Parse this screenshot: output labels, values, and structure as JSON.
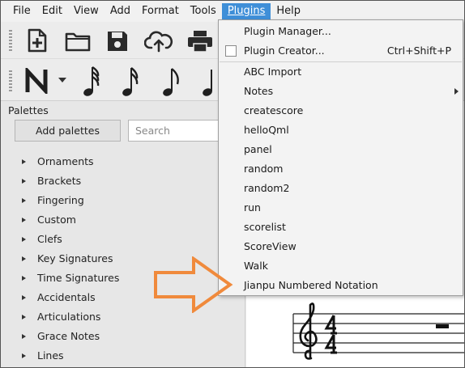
{
  "menubar": {
    "items": [
      {
        "label": "File"
      },
      {
        "label": "Edit"
      },
      {
        "label": "View"
      },
      {
        "label": "Add"
      },
      {
        "label": "Format"
      },
      {
        "label": "Tools"
      },
      {
        "label": "Plugins"
      },
      {
        "label": "Help"
      }
    ],
    "active": "Plugins"
  },
  "toolbar": {
    "icons": [
      "new-score-icon",
      "open-folder-icon",
      "save-icon",
      "cloud-upload-icon",
      "print-icon"
    ]
  },
  "note_toolbar": {
    "icons": [
      "note-input-icon",
      "sixty-fourth-note-icon",
      "thirty-second-note-icon",
      "eighth-note-icon",
      "quarter-note-icon"
    ]
  },
  "palettes": {
    "title": "Palettes",
    "add_button": "Add palettes",
    "search_placeholder": "Search",
    "items": [
      {
        "label": "Ornaments"
      },
      {
        "label": "Brackets"
      },
      {
        "label": "Fingering"
      },
      {
        "label": "Custom"
      },
      {
        "label": "Clefs"
      },
      {
        "label": "Key Signatures"
      },
      {
        "label": "Time Signatures"
      },
      {
        "label": "Accidentals"
      },
      {
        "label": "Articulations"
      },
      {
        "label": "Grace Notes"
      },
      {
        "label": "Lines"
      }
    ]
  },
  "plugins_menu": {
    "plugin_manager": "Plugin Manager...",
    "plugin_creator": "Plugin Creator...",
    "plugin_creator_shortcut": "Ctrl+Shift+P",
    "items": [
      {
        "label": "ABC Import"
      },
      {
        "label": "Notes"
      },
      {
        "label": "createscore"
      },
      {
        "label": "helloQml"
      },
      {
        "label": "panel"
      },
      {
        "label": "random"
      },
      {
        "label": "random2"
      },
      {
        "label": "run"
      },
      {
        "label": "scorelist"
      },
      {
        "label": "ScoreView"
      },
      {
        "label": "Walk"
      },
      {
        "label": "Jianpu Numbered Notation"
      }
    ]
  },
  "colors": {
    "menu_highlight": "#3f8fd8",
    "annotation_arrow": "#f08a3c"
  }
}
